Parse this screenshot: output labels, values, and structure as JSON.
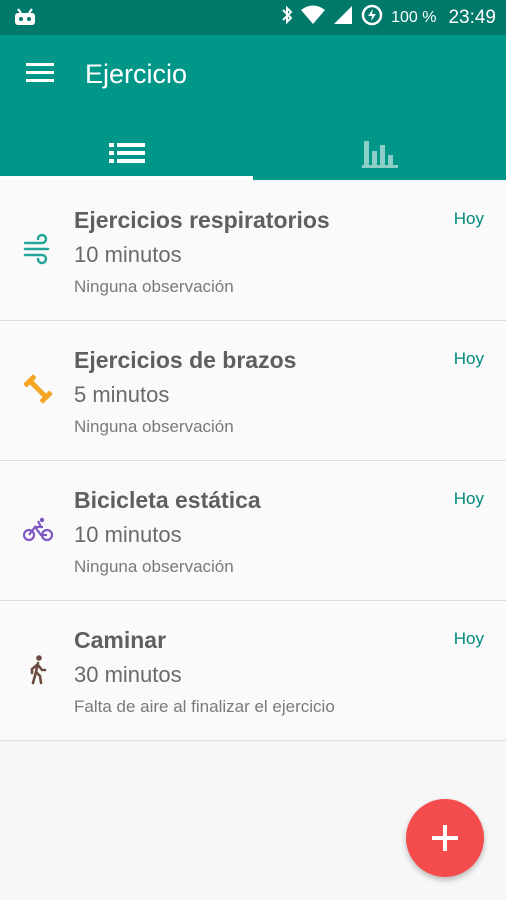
{
  "status_bar": {
    "battery": "100 %",
    "time": "23:49",
    "icons": [
      "android-icon",
      "bluetooth-icon",
      "wifi-icon",
      "signal-icon",
      "battery-saver-icon"
    ]
  },
  "app_bar": {
    "title": "Ejercicio",
    "menu_icon": "menu-icon",
    "tabs": [
      {
        "icon": "list-icon",
        "active": true
      },
      {
        "icon": "bar-chart-icon",
        "active": false
      }
    ],
    "color": "#009688"
  },
  "exercises": [
    {
      "name": "Ejercicios respiratorios",
      "duration": "10 minutos",
      "note": "Ninguna observación",
      "date": "Hoy",
      "icon": "wind-icon",
      "icon_color": "#26a69a"
    },
    {
      "name": "Ejercicios de brazos",
      "duration": "5 minutos",
      "note": "Ninguna observación",
      "date": "Hoy",
      "icon": "dumbbell-icon",
      "icon_color": "#f5a623"
    },
    {
      "name": "Bicicleta estática",
      "duration": "10 minutos",
      "note": "Ninguna observación",
      "date": "Hoy",
      "icon": "bicycle-icon",
      "icon_color": "#7e57c2"
    },
    {
      "name": "Caminar",
      "duration": "30 minutos",
      "note": "Falta de aire al finalizar el ejercicio",
      "date": "Hoy",
      "icon": "walk-icon",
      "icon_color": "#6d4c41"
    }
  ],
  "fab": {
    "icon": "plus-icon",
    "color": "#f44c4c"
  }
}
